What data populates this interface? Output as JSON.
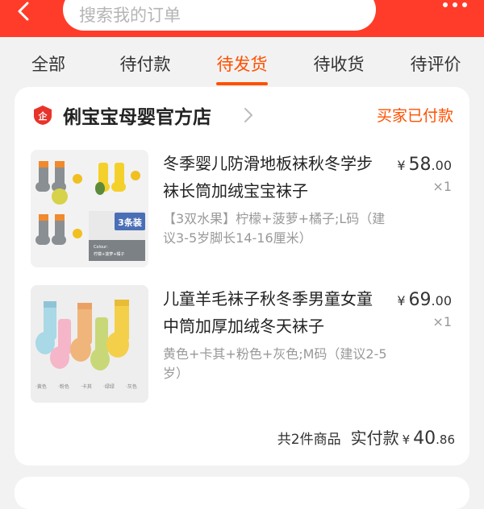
{
  "header": {
    "search_placeholder": "搜索我的订单",
    "back_icon": "back-arrow-icon",
    "more_icon": "more-dots-icon"
  },
  "tabs": [
    {
      "label": "全部",
      "active": false
    },
    {
      "label": "待付款",
      "active": false
    },
    {
      "label": "待发货",
      "active": true
    },
    {
      "label": "待收货",
      "active": false
    },
    {
      "label": "待评价",
      "active": false
    }
  ],
  "colors": {
    "header_bg": "#ff3c2a",
    "accent": "#ff5000",
    "shop_badge": "#e8332a"
  },
  "order": {
    "shop_name": "俐宝宝母婴官方店",
    "status": "买家已付款",
    "items": [
      {
        "title": "冬季婴儿防滑地板袜秋冬学步袜长筒加绒宝宝袜子",
        "sku": "【3双水果】柠檬+菠萝+橘子;L码（建议3-5岁脚长14-16厘米）",
        "price_symbol": "¥",
        "price_int": "58",
        "price_dec": ".00",
        "qty": "×1",
        "thumb_labels": {
          "badge": "3条装",
          "caption_en": "Colour:",
          "caption_cn": "柠檬+菠萝+橘子"
        }
      },
      {
        "title": "儿童羊毛袜子秋冬季男童女童中筒加厚加绒冬天袜子",
        "sku": "黄色+卡其+粉色+灰色;M码（建议2-5岁）",
        "price_symbol": "¥",
        "price_int": "69",
        "price_dec": ".00",
        "qty": "×1",
        "thumb_labels": {
          "c1": "·黄色",
          "c2": "·粉色",
          "c3": "·卡其",
          "c4": "·绿绿",
          "c5": "·灰色"
        }
      }
    ],
    "summary": {
      "count_text": "共2件商品",
      "paid_label": "实付款",
      "price_symbol": "¥",
      "price_int": "40",
      "price_dec": ".86"
    }
  }
}
